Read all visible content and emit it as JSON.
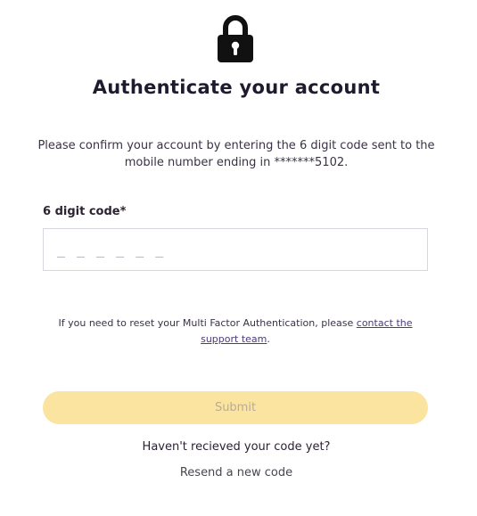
{
  "icons": {
    "header": "lock-icon"
  },
  "colors": {
    "title": "#1f1a2e",
    "submit_bg": "#fbe3a0",
    "submit_text": "#b6ad95",
    "link": "#4b3b78",
    "input_border": "#d6d6dc"
  },
  "page": {
    "title": "Authenticate your account",
    "description": "Please confirm your account by entering the 6 digit code sent to the mobile number ending in *******5102."
  },
  "form": {
    "code_label": "6 digit code*",
    "code_value": "",
    "code_placeholder": "_ _ _ _ _ _",
    "reset_text": "If you need to reset your Multi Factor Authentication, please ",
    "support_link": "contact the support team",
    "reset_suffix": ".",
    "submit_label": "Submit"
  },
  "footer": {
    "not_received": "Haven't recieved your code yet?",
    "resend_label": "Resend a new code"
  }
}
